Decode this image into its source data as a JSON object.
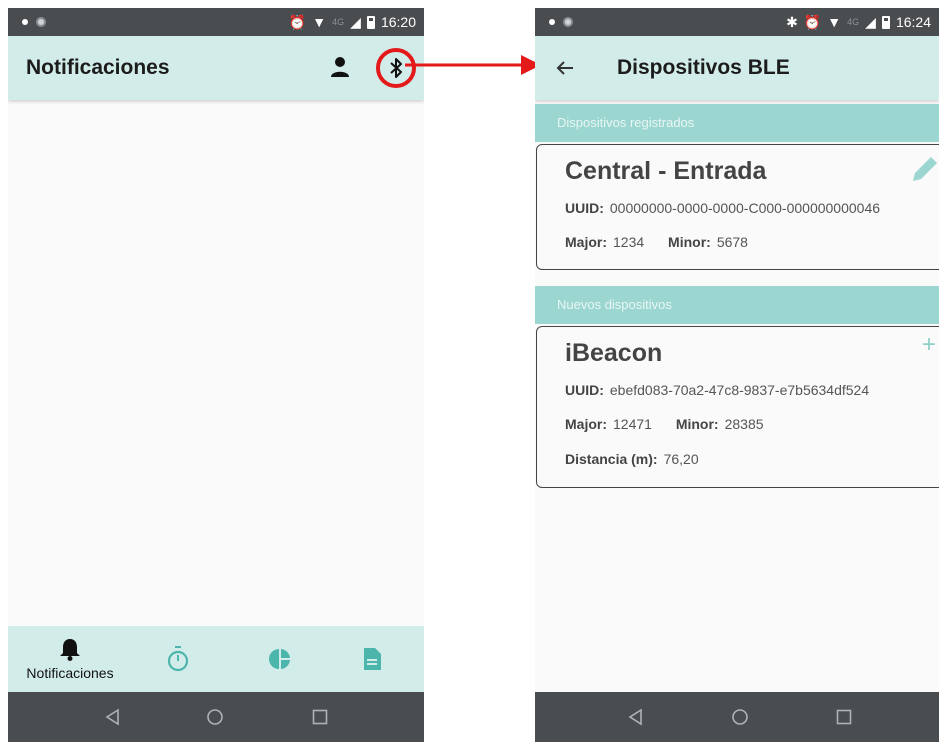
{
  "colors": {
    "appbar_bg": "#d2ede9",
    "section_header_bg": "#9bd6d1",
    "status_bar_bg": "#4a4d50",
    "highlight_red": "#e41a1a",
    "add_accent": "#8ccfc9"
  },
  "left_screen": {
    "status_bar": {
      "time": "16:20",
      "network": "4G",
      "icons": [
        "notification-dot-icon",
        "app-circle-icon",
        "alarm-icon",
        "wifi-icon",
        "signal-icon",
        "battery-icon"
      ]
    },
    "appbar": {
      "title": "Notificaciones",
      "actions": [
        "person-icon",
        "bluetooth-icon"
      ]
    },
    "bottom_nav": {
      "items": [
        {
          "icon": "bell-icon",
          "label": "Notificaciones"
        },
        {
          "icon": "stopwatch-icon",
          "label": ""
        },
        {
          "icon": "pie-chart-icon",
          "label": ""
        },
        {
          "icon": "document-icon",
          "label": ""
        }
      ]
    },
    "system_nav": [
      "back-triangle-icon",
      "home-circle-icon",
      "recents-square-icon"
    ]
  },
  "right_screen": {
    "status_bar": {
      "time": "16:24",
      "network": "4G",
      "icons": [
        "notification-dot-icon",
        "app-circle-icon",
        "bluetooth-icon",
        "alarm-icon",
        "wifi-icon",
        "signal-icon",
        "battery-icon"
      ]
    },
    "appbar": {
      "title": "Dispositivos BLE"
    },
    "registered_section": {
      "header": "Dispositivos registrados",
      "device": {
        "name": "Central - Entrada",
        "uuid_label": "UUID:",
        "uuid": "00000000-0000-0000-C000-000000000046",
        "major_label": "Major:",
        "major": "1234",
        "minor_label": "Minor:",
        "minor": "5678"
      }
    },
    "new_section": {
      "header": "Nuevos dispositivos",
      "device": {
        "name": "iBeacon",
        "uuid_label": "UUID:",
        "uuid": "ebefd083-70a2-47c8-9837-e7b5634df524",
        "major_label": "Major:",
        "major": "12471",
        "minor_label": "Minor:",
        "minor": "28385",
        "distance_label": "Distancia (m):",
        "distance": "76,20"
      }
    },
    "system_nav": [
      "back-triangle-icon",
      "home-circle-icon",
      "recents-square-icon"
    ]
  }
}
